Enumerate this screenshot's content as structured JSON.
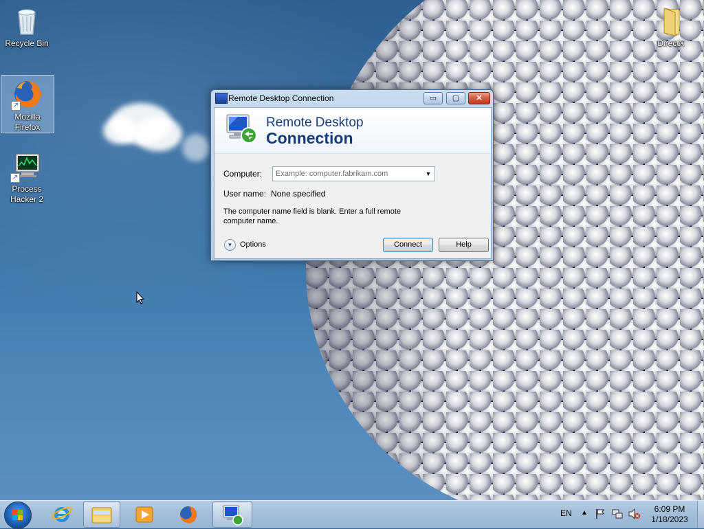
{
  "desktop": {
    "icons": [
      {
        "label": "Recycle Bin",
        "icon": "recycle-bin-icon"
      },
      {
        "label": "Mozilla Firefox",
        "icon": "firefox-icon"
      },
      {
        "label": "Process Hacker 2",
        "icon": "process-hacker-icon"
      },
      {
        "label": "DirectX",
        "icon": "folder-icon"
      }
    ]
  },
  "dialog": {
    "title": "Remote Desktop Connection",
    "banner_line1": "Remote Desktop",
    "banner_line2": "Connection",
    "computer_label": "Computer:",
    "computer_placeholder": "Example: computer.fabrikam.com",
    "username_label": "User name:",
    "username_value": "None specified",
    "message": "The computer name field is blank. Enter a full remote computer name.",
    "options_label": "Options",
    "connect_label": "Connect",
    "help_label": "Help",
    "minimize_glyph": "▭",
    "maximize_glyph": "▢",
    "close_glyph": "✕"
  },
  "taskbar": {
    "items": [
      "start-button",
      "internet-explorer-icon",
      "windows-explorer-icon",
      "media-player-icon",
      "firefox-icon",
      "remote-desktop-icon"
    ],
    "language": "EN",
    "clock_time": "6:09 PM",
    "clock_date": "1/18/2023"
  },
  "colors": {
    "banner_text": "#143a79",
    "taskbar": "#a6c0db",
    "close_button": "#c2361c"
  }
}
